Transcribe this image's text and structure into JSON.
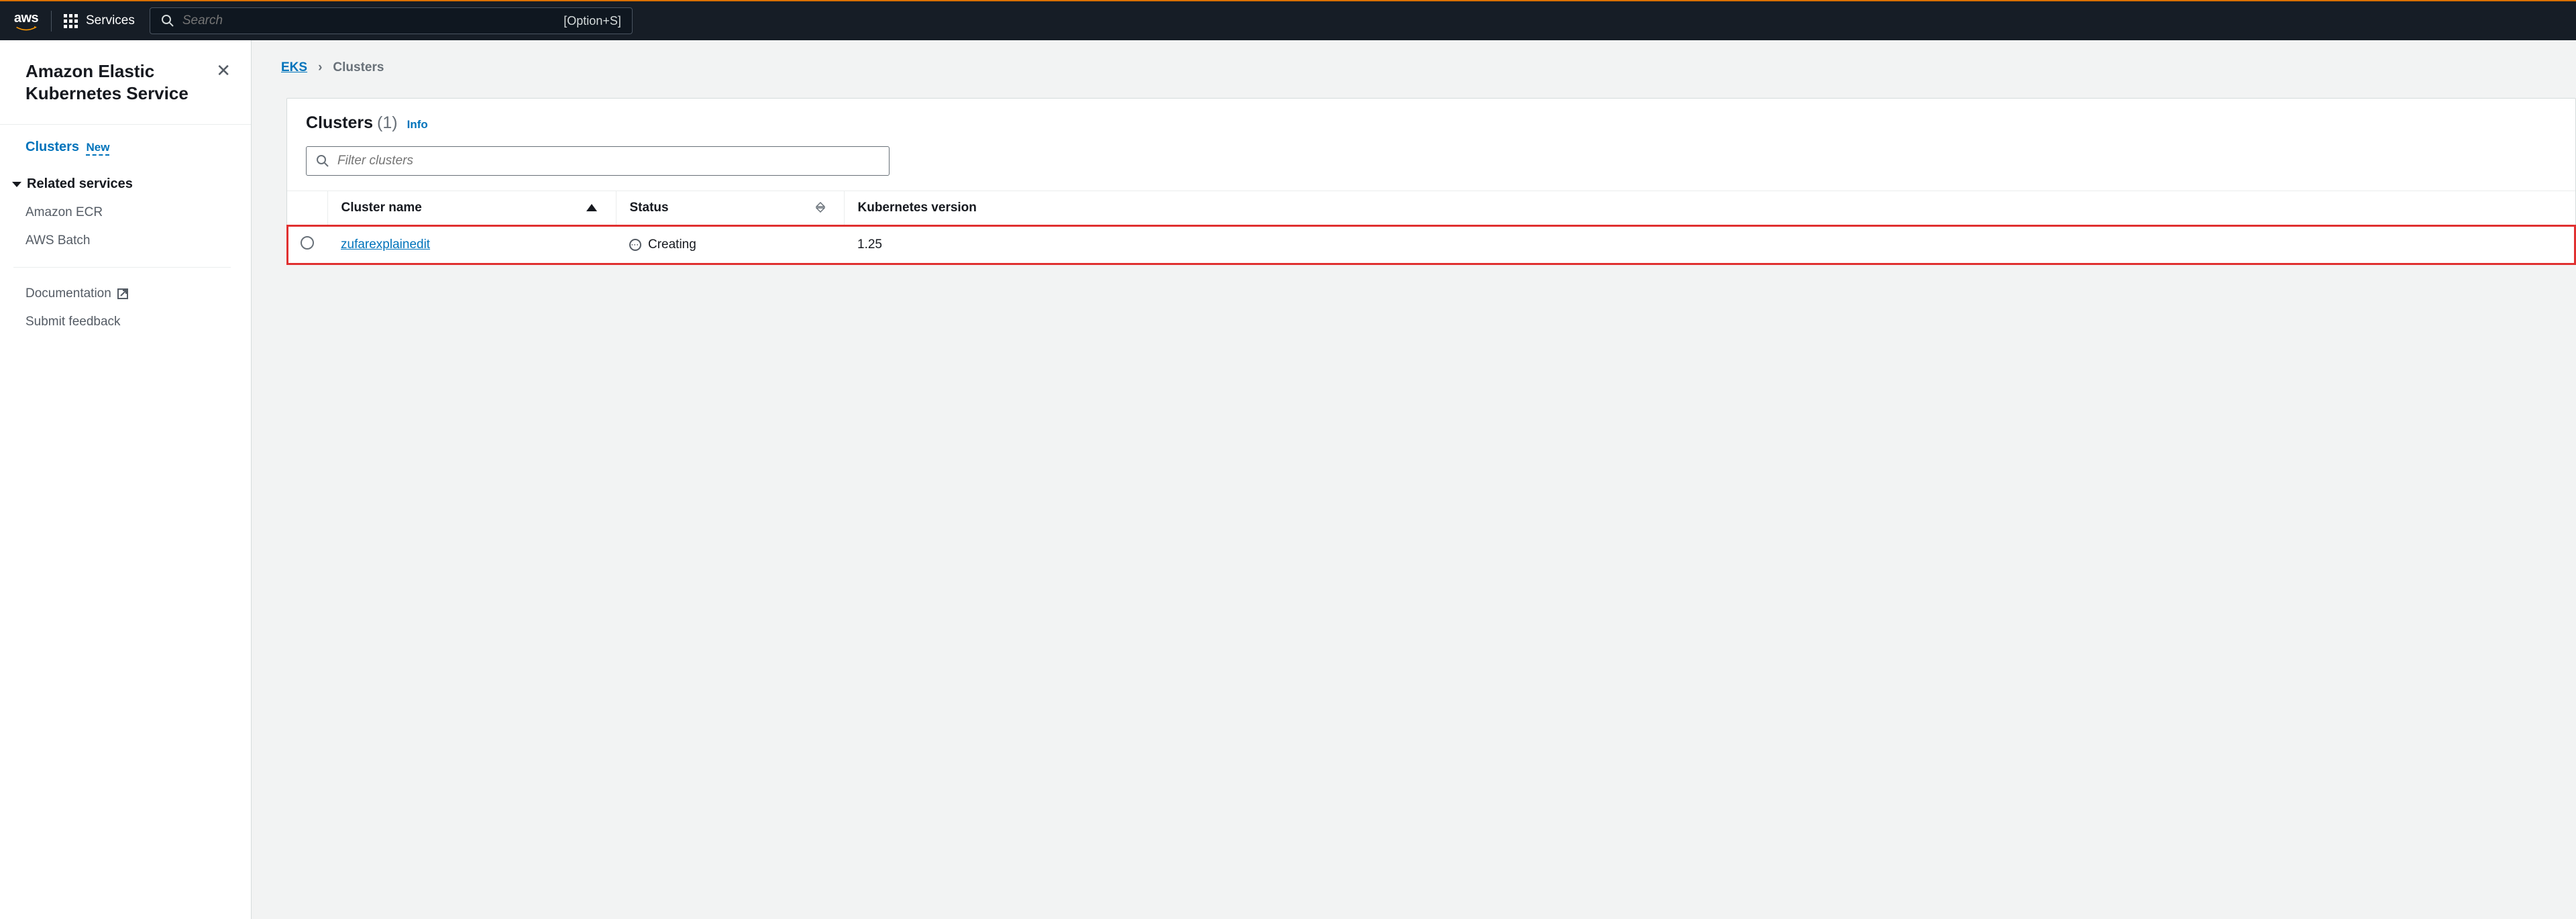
{
  "nav": {
    "logo_text": "aws",
    "services_label": "Services",
    "search_placeholder": "Search",
    "search_shortcut": "[Option+S]"
  },
  "sidebar": {
    "title": "Amazon Elastic Kubernetes Service",
    "clusters_label": "Clusters",
    "new_badge": "New",
    "related_header": "Related services",
    "related_items": [
      "Amazon ECR",
      "AWS Batch"
    ],
    "doc_label": "Documentation",
    "feedback_label": "Submit feedback"
  },
  "breadcrumb": {
    "root": "EKS",
    "current": "Clusters"
  },
  "panel": {
    "title": "Clusters",
    "count": "(1)",
    "info_label": "Info",
    "filter_placeholder": "Filter clusters"
  },
  "table": {
    "headers": {
      "name": "Cluster name",
      "status": "Status",
      "version": "Kubernetes version"
    },
    "rows": [
      {
        "name": "zufarexplainedit",
        "status": "Creating",
        "version": "1.25"
      }
    ]
  }
}
